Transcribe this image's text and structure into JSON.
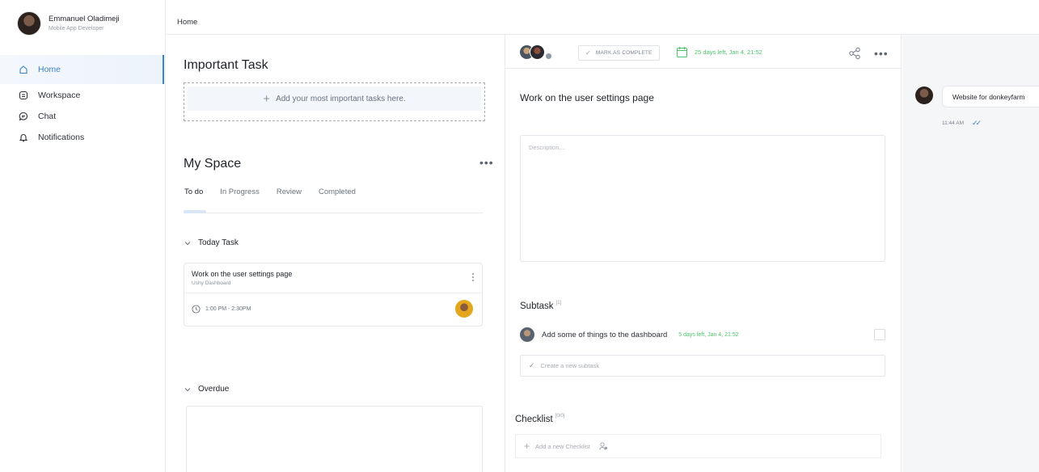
{
  "user": {
    "name": "Emmanuel Oladimeji",
    "role": "Mobile App Developer"
  },
  "nav": [
    {
      "label": "Home",
      "icon": "home-icon"
    },
    {
      "label": "Workspace",
      "icon": "workspace-icon"
    },
    {
      "label": "Chat",
      "icon": "chat-icon"
    },
    {
      "label": "Notifications",
      "icon": "bell-icon"
    }
  ],
  "breadcrumb": "Home",
  "important": {
    "title": "Important Task",
    "add_label": "Add your most important tasks here."
  },
  "myspace": {
    "title": "My Space",
    "tabs": [
      "To do",
      "In Progress",
      "Review",
      "Completed"
    ],
    "active_tab": "To do",
    "sections": {
      "today": "Today Task",
      "overdue": "Overdue"
    },
    "task": {
      "title": "Work on the user settings page",
      "project": "Ushy Dashboard",
      "time": "1:00 PM - 2:30PM"
    }
  },
  "detail": {
    "mark_complete": "MARK AS COMPLETE",
    "due": "25 days left, Jan 4, 21:52",
    "title": "Work on the user settings page",
    "description_placeholder": "Description....",
    "subtask_title": "Subtask",
    "subtask_count": "[1]",
    "subtask": {
      "text": "Add some of things to the dashboard",
      "due": "5 days left, Jan 4, 21:52"
    },
    "new_subtask_placeholder": "Create a new subtask",
    "checklist_title": "Checklist",
    "checklist_count": "[0/0]",
    "add_checklist": "Add a new Checklist"
  },
  "chat": {
    "message": "Website for donkeyfarm",
    "time": "11:44 AM"
  },
  "colors": {
    "accent": "#3b82c4",
    "success": "#4cc46a"
  }
}
